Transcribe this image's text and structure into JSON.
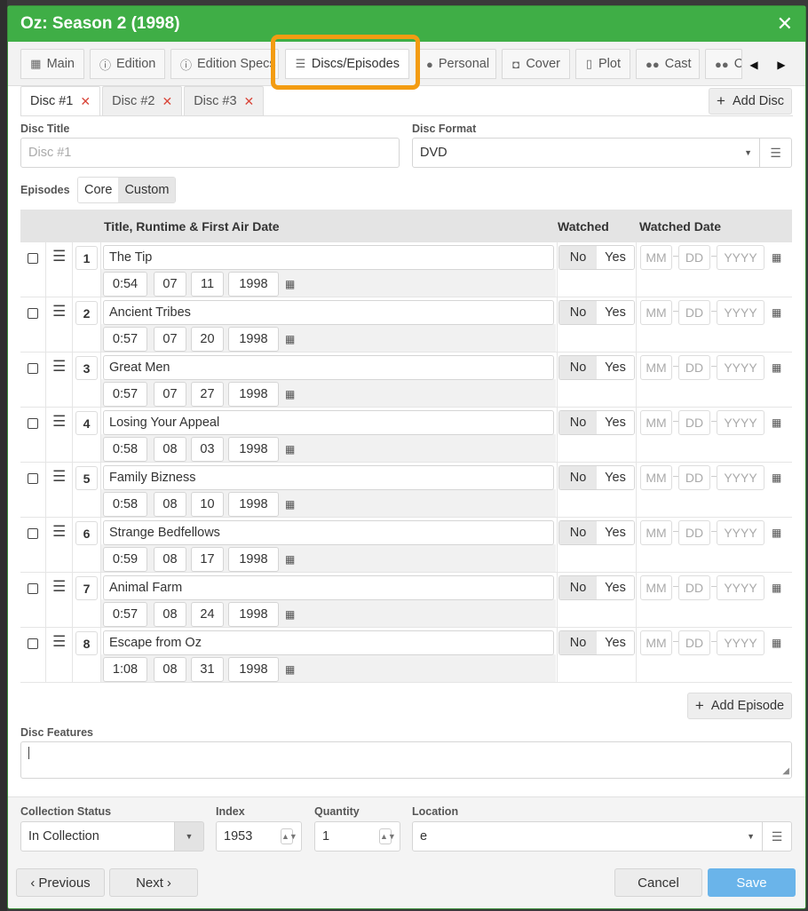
{
  "window": {
    "title": "Oz: Season 2 (1998)",
    "close_glyph": "✕"
  },
  "tabs": [
    {
      "label": "Main",
      "icon": "film-icon"
    },
    {
      "label": "Edition",
      "icon": "info-icon"
    },
    {
      "label": "Edition Specs",
      "icon": "info-icon"
    },
    {
      "label": "Discs/Episodes",
      "icon": "list-numbered-icon",
      "active": true
    },
    {
      "label": "Personal",
      "icon": "user-icon"
    },
    {
      "label": "Cover",
      "icon": "camera-icon"
    },
    {
      "label": "Plot",
      "icon": "document-icon"
    },
    {
      "label": "Cast",
      "icon": "users-icon"
    },
    {
      "label": "C",
      "icon": "users-icon"
    }
  ],
  "discs": {
    "tabs": [
      {
        "label": "Disc #1",
        "active": true
      },
      {
        "label": "Disc #2"
      },
      {
        "label": "Disc #3"
      }
    ],
    "add_label": "Add Disc",
    "remove_glyph": "✕"
  },
  "form": {
    "disc_title_label": "Disc Title",
    "disc_title_placeholder": "Disc #1",
    "disc_format_label": "Disc Format",
    "disc_format_value": "DVD",
    "episodes_label": "Episodes",
    "episodes_toggle": [
      "Core",
      "Custom"
    ]
  },
  "table": {
    "headers": {
      "title": "Title, Runtime & First Air Date",
      "watched": "Watched",
      "watched_date": "Watched Date"
    },
    "no_label": "No",
    "yes_label": "Yes",
    "mm_placeholder": "MM",
    "dd_placeholder": "DD",
    "yyyy_placeholder": "YYYY",
    "episodes": [
      {
        "num": "1",
        "title": "The Tip",
        "runtime": "0:54",
        "mm": "07",
        "dd": "11",
        "yyyy": "1998"
      },
      {
        "num": "2",
        "title": "Ancient Tribes",
        "runtime": "0:57",
        "mm": "07",
        "dd": "20",
        "yyyy": "1998"
      },
      {
        "num": "3",
        "title": "Great Men",
        "runtime": "0:57",
        "mm": "07",
        "dd": "27",
        "yyyy": "1998"
      },
      {
        "num": "4",
        "title": "Losing Your Appeal",
        "runtime": "0:58",
        "mm": "08",
        "dd": "03",
        "yyyy": "1998"
      },
      {
        "num": "5",
        "title": "Family Bizness",
        "runtime": "0:58",
        "mm": "08",
        "dd": "10",
        "yyyy": "1998"
      },
      {
        "num": "6",
        "title": "Strange Bedfellows",
        "runtime": "0:59",
        "mm": "08",
        "dd": "17",
        "yyyy": "1998"
      },
      {
        "num": "7",
        "title": "Animal Farm",
        "runtime": "0:57",
        "mm": "08",
        "dd": "24",
        "yyyy": "1998"
      },
      {
        "num": "8",
        "title": "Escape from Oz",
        "runtime": "1:08",
        "mm": "08",
        "dd": "31",
        "yyyy": "1998"
      }
    ],
    "add_episode_label": "Add Episode"
  },
  "features": {
    "label": "Disc Features",
    "value": ""
  },
  "collection": {
    "status_label": "Collection Status",
    "status_value": "In Collection",
    "index_label": "Index",
    "index_value": "1953",
    "quantity_label": "Quantity",
    "quantity_value": "1",
    "location_label": "Location",
    "location_value": "e"
  },
  "footer": {
    "previous_label": "Previous",
    "next_label": "Next",
    "cancel_label": "Cancel",
    "save_label": "Save"
  },
  "colors": {
    "titlebar": "#3fae46",
    "highlight": "#f39c12",
    "save": "#6ab4ea",
    "remove": "#d9463a"
  }
}
